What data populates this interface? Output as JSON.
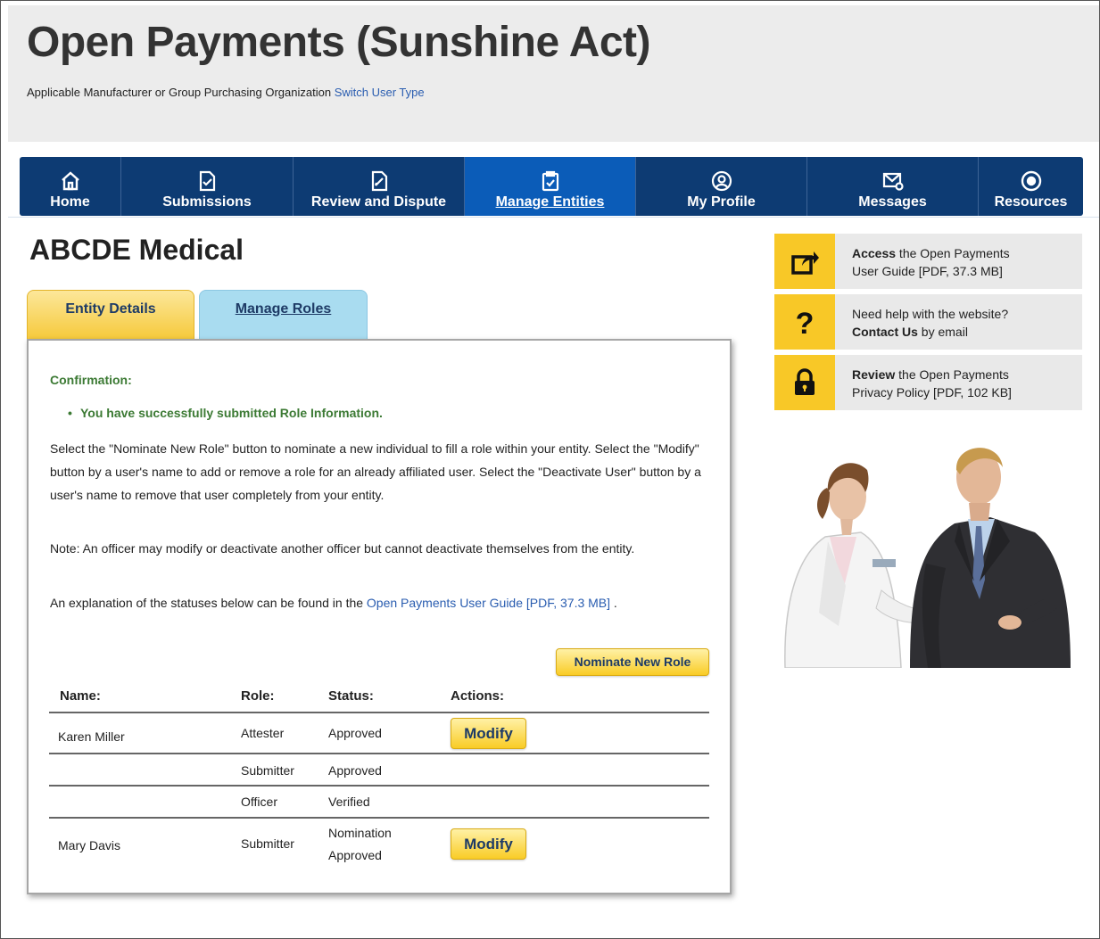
{
  "header": {
    "title": "Open Payments (Sunshine Act)",
    "user_type": "Applicable Manufacturer or Group Purchasing Organization",
    "switch_link": "Switch User Type"
  },
  "nav": {
    "items": [
      {
        "label": "Home",
        "icon": "home-icon"
      },
      {
        "label": "Submissions",
        "icon": "submissions-icon"
      },
      {
        "label": "Review and Dispute",
        "icon": "review-icon"
      },
      {
        "label": "Manage Entities",
        "icon": "clipboard-icon",
        "active": true
      },
      {
        "label": "My Profile",
        "icon": "profile-icon"
      },
      {
        "label": "Messages",
        "icon": "messages-icon"
      },
      {
        "label": "Resources",
        "icon": "resources-icon"
      }
    ]
  },
  "entity": {
    "name": "ABCDE Medical"
  },
  "tabs": {
    "details": "Entity Details",
    "roles": "Manage Roles"
  },
  "confirmation": {
    "title": "Confirmation:",
    "message": "You have successfully submitted Role Information."
  },
  "instructions": {
    "p1": "Select the \"Nominate New Role\" button to nominate a new individual to fill a role within your entity. Select the \"Modify\" button by a user's name to add or remove a role for an already affiliated user. Select the \"Deactivate User\" button by a user's name to remove that user completely from your entity.",
    "p2": "Note: An officer may modify or deactivate another officer but cannot deactivate themselves from the entity.",
    "p3_prefix": "An explanation of the statuses below can be found in the ",
    "p3_link": "Open Payments User Guide [PDF, 37.3 MB]",
    "p3_suffix": " ."
  },
  "buttons": {
    "nominate": "Nominate New Role",
    "modify": "Modify"
  },
  "table": {
    "headers": {
      "name": "Name:",
      "role": "Role:",
      "status": "Status:",
      "actions": "Actions:"
    },
    "rows": [
      {
        "name": "Karen Miller",
        "role": "Attester",
        "status": "Approved",
        "action": "Modify"
      },
      {
        "name": "",
        "role": "Submitter",
        "status": "Approved",
        "action": ""
      },
      {
        "name": "",
        "role": "Officer",
        "status": "Verified",
        "action": ""
      },
      {
        "name": "Mary Davis",
        "role": "Submitter",
        "status_line1": "Nomination",
        "status_line2": "Approved",
        "action": "Modify"
      }
    ]
  },
  "sidebar": {
    "guide": {
      "bold": "Access",
      "rest1": " the Open Payments",
      "line2": "User Guide [PDF, 37.3 MB]",
      "icon": "share-icon"
    },
    "help": {
      "line1": "Need help with the website?",
      "bold": "Contact Us",
      "rest2": " by email",
      "icon": "question-icon"
    },
    "privacy": {
      "bold": "Review",
      "rest1": " the Open Payments",
      "line2": "Privacy Policy [PDF, 102 KB]",
      "icon": "lock-icon"
    }
  },
  "colors": {
    "nav_bg": "#0d3b73",
    "nav_active": "#0b5cb8",
    "accent_yellow": "#f8c827",
    "confirm_green": "#3c7a34",
    "link_blue": "#2a5db0"
  }
}
